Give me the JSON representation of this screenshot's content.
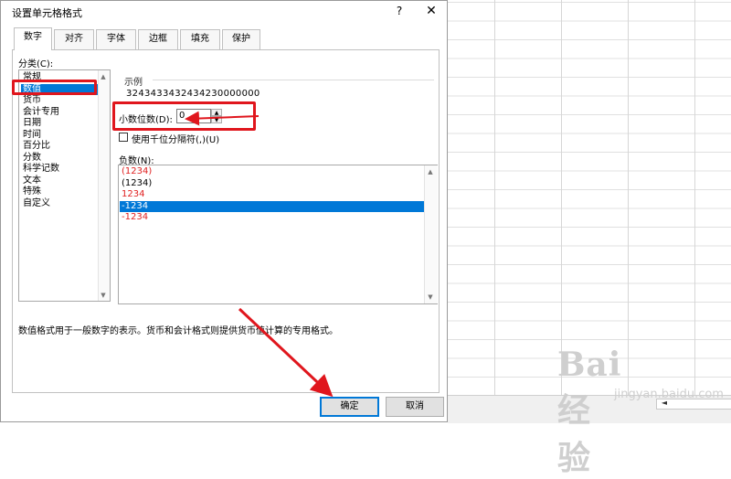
{
  "dialog": {
    "title": "设置单元格格式",
    "help": "?",
    "close": "✕"
  },
  "tabs": [
    {
      "label": "数字",
      "active": true
    },
    {
      "label": "对齐"
    },
    {
      "label": "字体"
    },
    {
      "label": "边框"
    },
    {
      "label": "填充"
    },
    {
      "label": "保护"
    }
  ],
  "category": {
    "label": "分类(C):",
    "items": [
      "常规",
      "数值",
      "货币",
      "会计专用",
      "日期",
      "时间",
      "百分比",
      "分数",
      "科学记数",
      "文本",
      "特殊",
      "自定义"
    ],
    "selected": "数值"
  },
  "sample": {
    "label": "示例",
    "value": "3243433432434230000000"
  },
  "decimal": {
    "label": "小数位数(D):",
    "value": "0"
  },
  "thousands": {
    "label": "使用千位分隔符(,)(U)",
    "checked": false
  },
  "negative": {
    "label": "负数(N):",
    "items": [
      "(1234)",
      "(1234)",
      "1234",
      "-1234",
      "-1234"
    ]
  },
  "description": "数值格式用于一般数字的表示。货币和会计格式则提供货币值计算的专用格式。",
  "buttons": {
    "ok": "确定",
    "cancel": "取消"
  },
  "watermark": {
    "logo": "Bai 经验",
    "url": "jingyan.baidu.com"
  },
  "colors": {
    "selection": "#0078d7",
    "negative_red": "#e02020",
    "highlight_red": "#e0161d"
  },
  "icons": {
    "spin_up": "▲",
    "spin_down": "▼",
    "scroll_up": "▲",
    "scroll_down": "▼",
    "scroll_left": "◄"
  }
}
